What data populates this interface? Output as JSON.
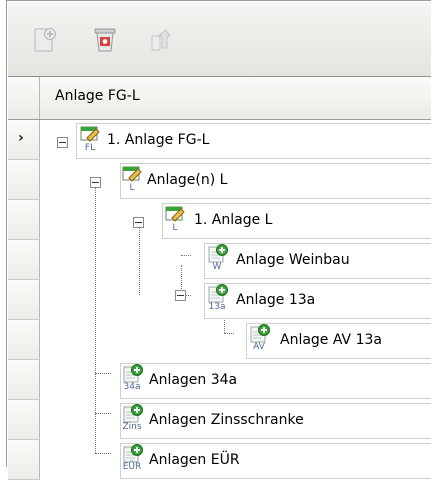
{
  "toolbar": {
    "buttons": [
      {
        "icon": "add-document-icon"
      },
      {
        "icon": "delete-icon"
      },
      {
        "icon": "level-up-icon"
      }
    ]
  },
  "grid": {
    "header": "Anlage FG-L",
    "rows": [
      {
        "label": "1. Anlage FG-L",
        "icon_sub": "FL",
        "selected": true
      },
      {
        "label": "Anlage(n) L",
        "icon_sub": "L"
      },
      {
        "label": "1. Anlage L",
        "icon_sub": "L"
      },
      {
        "label": "Anlage Weinbau",
        "icon_sub": "W"
      },
      {
        "label": "Anlage 13a",
        "icon_sub": "13a"
      },
      {
        "label": "Anlage AV 13a",
        "icon_sub": "AV"
      },
      {
        "label": "Anlagen 34a",
        "icon_sub": "34a"
      },
      {
        "label": "Anlagen Zinsschranke",
        "icon_sub": "Zins"
      },
      {
        "label": "Anlagen EÜR",
        "icon_sub": "EÜR"
      }
    ]
  },
  "colors": {
    "accent_green": "#3aa33a",
    "delete_red": "#d94040",
    "icon_blue": "#4a6a9a"
  }
}
